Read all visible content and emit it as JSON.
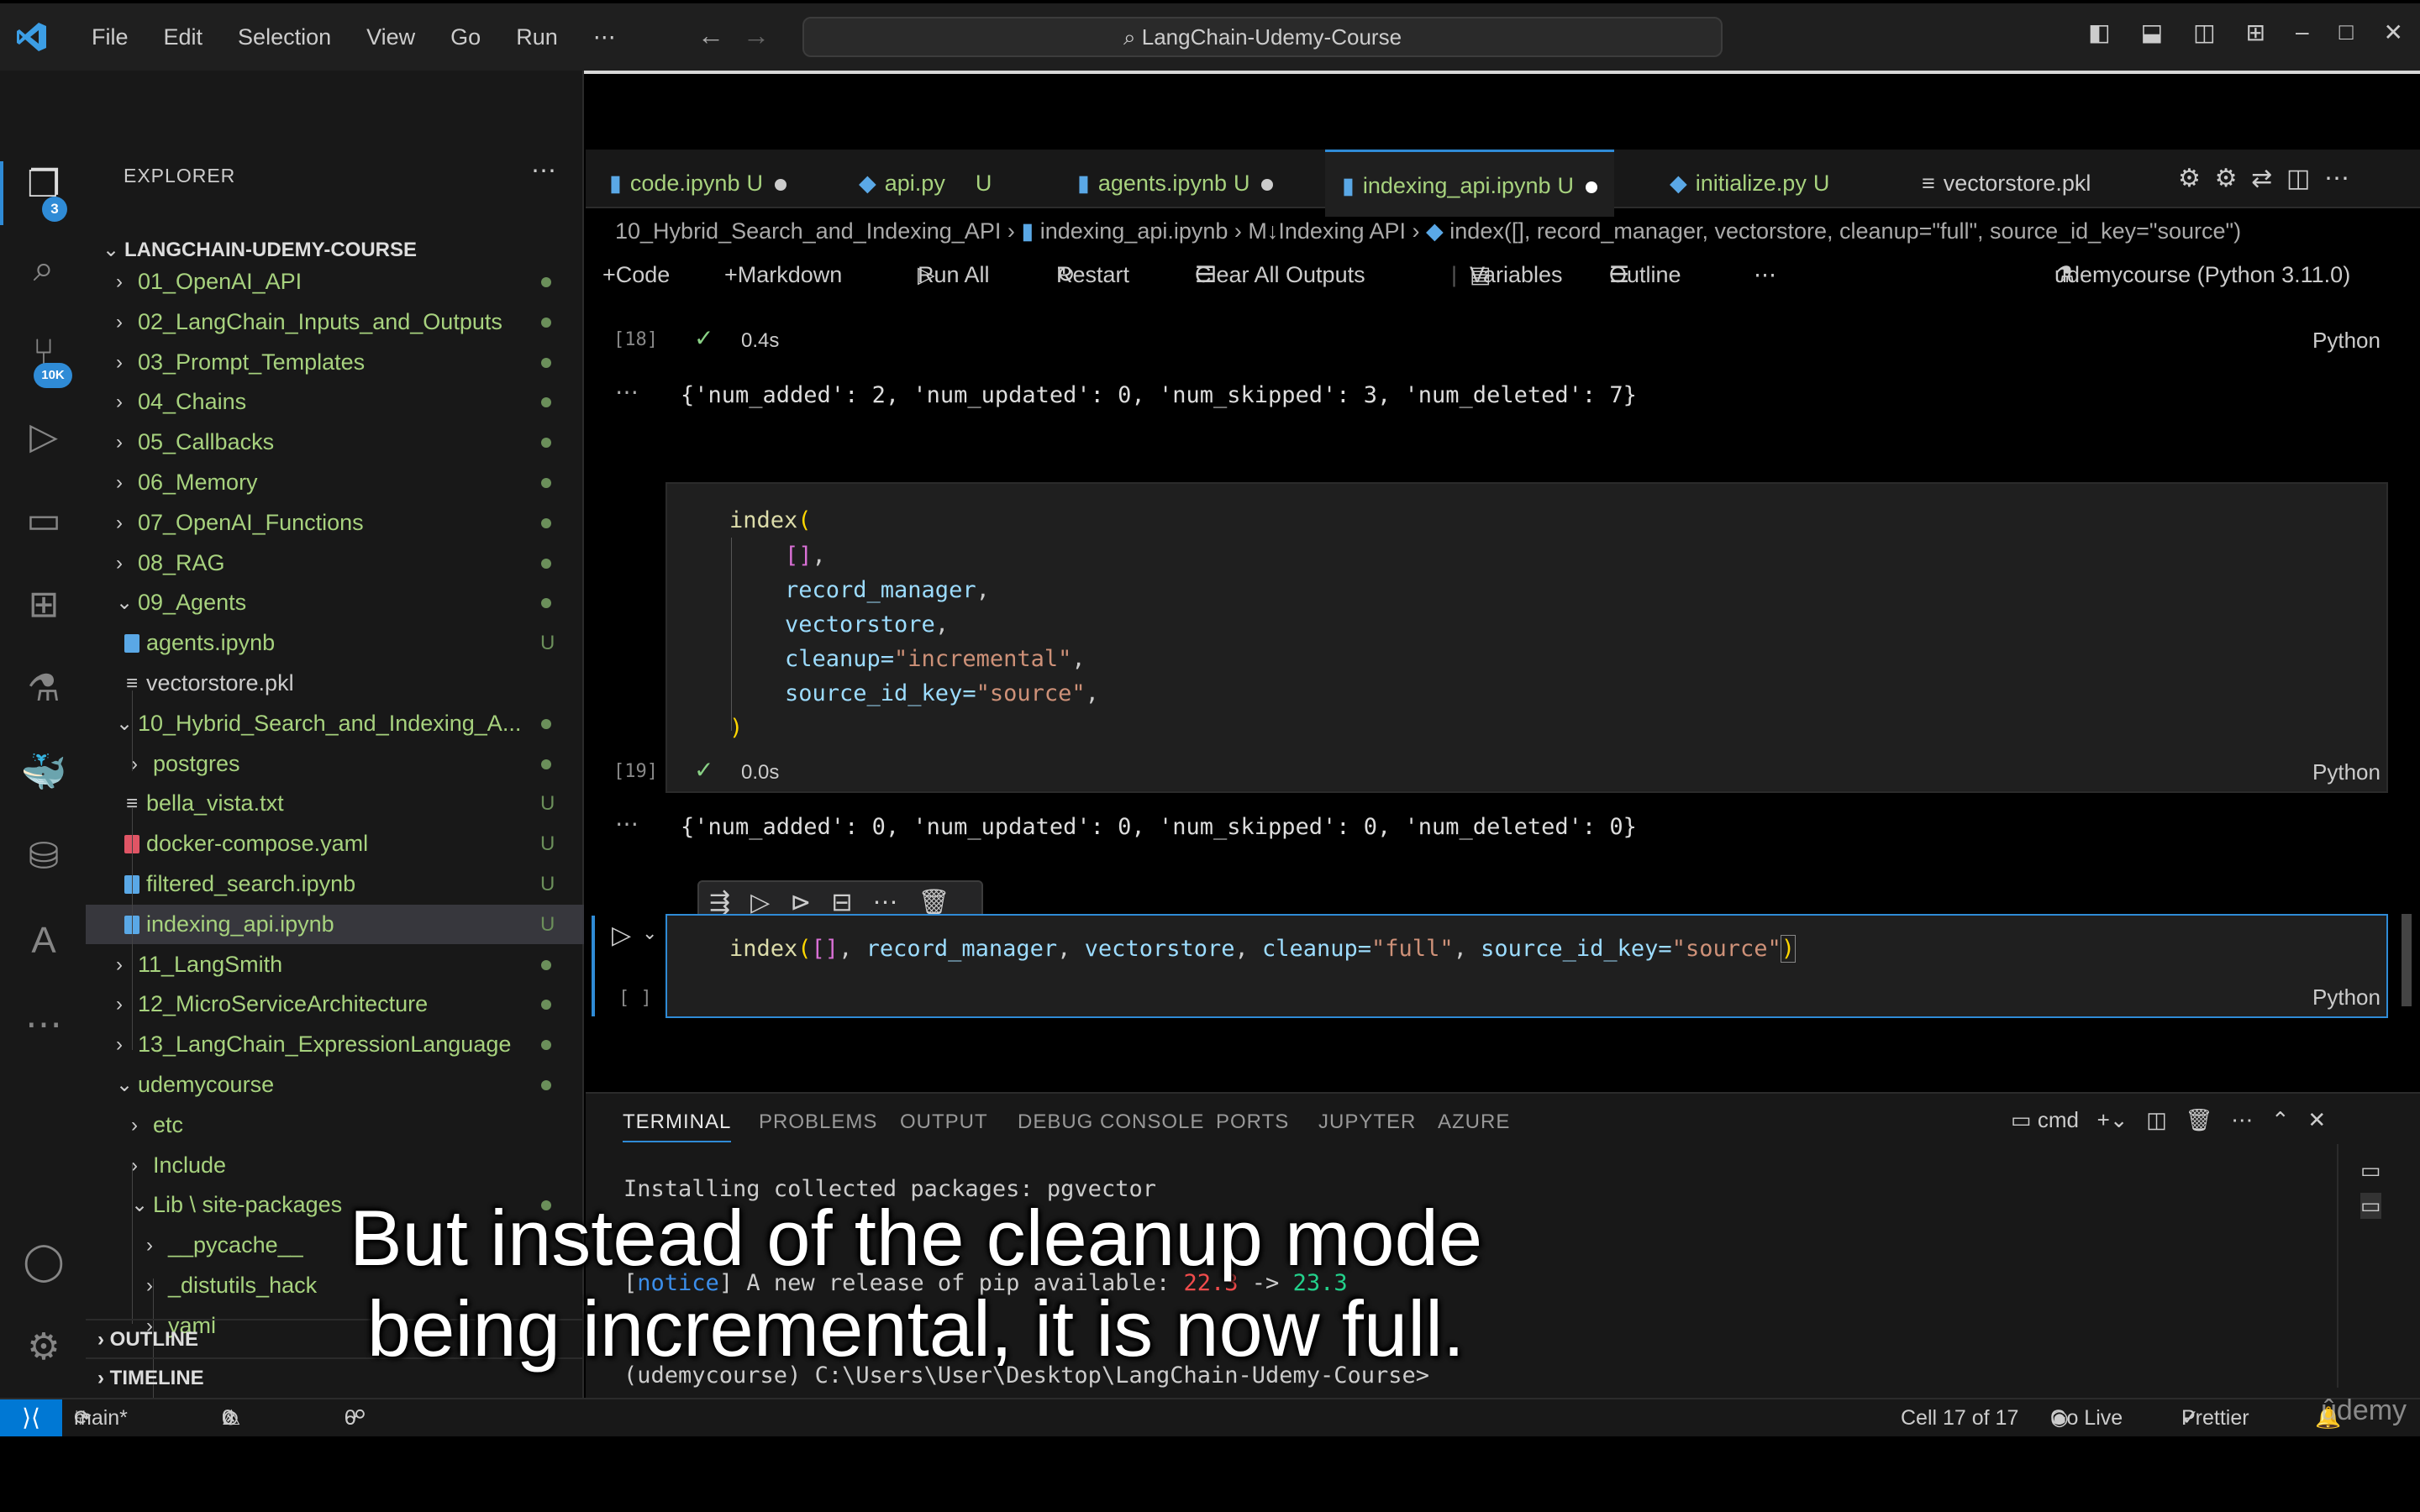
{
  "titlebar": {
    "menu": [
      "File",
      "Edit",
      "Selection",
      "View",
      "Go",
      "Run",
      "⋯"
    ],
    "search": "LangChain-Udemy-Course"
  },
  "activity": {
    "explorer_badge": "3",
    "scm_badge": "10K"
  },
  "sidebar": {
    "title": "EXPLORER",
    "root": "LANGCHAIN-UDEMY-COURSE",
    "items": [
      {
        "label": "01_OpenAI_API",
        "type": "folder"
      },
      {
        "label": "02_LangChain_Inputs_and_Outputs",
        "type": "folder"
      },
      {
        "label": "03_Prompt_Templates",
        "type": "folder"
      },
      {
        "label": "04_Chains",
        "type": "folder"
      },
      {
        "label": "05_Callbacks",
        "type": "folder"
      },
      {
        "label": "06_Memory",
        "type": "folder"
      },
      {
        "label": "07_OpenAI_Functions",
        "type": "folder"
      },
      {
        "label": "08_RAG",
        "type": "folder"
      },
      {
        "label": "09_Agents",
        "type": "folder-open"
      },
      {
        "label": "agents.ipynb",
        "type": "file",
        "status": "U"
      },
      {
        "label": "vectorstore.pkl",
        "type": "file"
      },
      {
        "label": "10_Hybrid_Search_and_Indexing_A...",
        "type": "folder-open"
      },
      {
        "label": "postgres",
        "type": "folder"
      },
      {
        "label": "bella_vista.txt",
        "type": "file",
        "status": "U"
      },
      {
        "label": "docker-compose.yaml",
        "type": "file",
        "status": "U"
      },
      {
        "label": "filtered_search.ipynb",
        "type": "file",
        "status": "U"
      },
      {
        "label": "indexing_api.ipynb",
        "type": "file",
        "status": "U"
      },
      {
        "label": "11_LangSmith",
        "type": "folder"
      },
      {
        "label": "12_MicroServiceArchitecture",
        "type": "folder"
      },
      {
        "label": "13_LangChain_ExpressionLanguage",
        "type": "folder"
      },
      {
        "label": "udemycourse",
        "type": "folder-open"
      },
      {
        "label": "etc",
        "type": "folder"
      },
      {
        "label": "Include",
        "type": "folder"
      },
      {
        "label": "Lib \\ site-packages",
        "type": "folder-open"
      },
      {
        "label": "__pycache__",
        "type": "folder"
      },
      {
        "label": "_distutils_hack",
        "type": "folder"
      },
      {
        "label": "yaml",
        "type": "folder"
      }
    ],
    "outline": "OUTLINE",
    "timeline": "TIMELINE"
  },
  "tabs": [
    {
      "label": "code.ipynb",
      "status": "U"
    },
    {
      "label": "api.py",
      "status": "U"
    },
    {
      "label": "agents.ipynb",
      "status": "U"
    },
    {
      "label": "indexing_api.ipynb",
      "status": "U"
    },
    {
      "label": "initialize.py",
      "status": "U"
    },
    {
      "label": "vectorstore.pkl",
      "status": ""
    }
  ],
  "breadcrumb": {
    "folder": "10_Hybrid_Search_and_Indexing_API",
    "file": "indexing_api.ipynb",
    "section": "M↓Indexing API",
    "symbol": "index([], record_manager, vectorstore, cleanup=\"full\", source_id_key=\"source\")"
  },
  "toolbar": {
    "code": "Code",
    "markdown": "Markdown",
    "run_all": "Run All",
    "restart": "Restart",
    "clear": "Clear All Outputs",
    "variables": "Variables",
    "outline": "Outline",
    "kernel": "udemycourse (Python 3.11.0)"
  },
  "cells": {
    "c18": {
      "exec": "[18]",
      "time": "0.4s",
      "lang": "Python",
      "output": "{'num_added': 2, 'num_updated': 0, 'num_skipped': 3, 'num_deleted': 7}"
    },
    "c19": {
      "exec": "[19]",
      "time": "0.0s",
      "lang": "Python",
      "output": "{'num_added': 0, 'num_updated': 0, 'num_skipped': 0, 'num_deleted': 0}",
      "code": {
        "fn": "index",
        "args_list": "[]",
        "rm": "record_manager",
        "vs": "vectorstore",
        "cleanup_kw": "cleanup=",
        "cleanup_val": "\"incremental\"",
        "sik_kw": "source_id_key=",
        "sik_val": "\"source\""
      }
    },
    "current": {
      "exec": "[ ]",
      "lang": "Python",
      "code": {
        "fn": "index",
        "list": "[]",
        "rm": "record_manager",
        "vs": "vectorstore",
        "cleanup_kw": "cleanup=",
        "cleanup_val": "\"full\"",
        "sik_kw": "source_id_key=",
        "sik_val": "\"source\""
      }
    }
  },
  "panel": {
    "tabs": [
      "TERMINAL",
      "PROBLEMS",
      "OUTPUT",
      "DEBUG CONSOLE",
      "PORTS",
      "JUPYTER",
      "AZURE"
    ],
    "shell": "cmd",
    "lines": {
      "l1": "Installing collected packages: pgvector",
      "notice_tag": "notice",
      "notice_text": " A new release of pip available: ",
      "old_ver": "22.3",
      "arrow": " -> ",
      "new_ver": "23.3",
      "prompt": "(udemycourse) C:\\Users\\User\\Desktop\\LangChain-Udemy-Course>"
    }
  },
  "status": {
    "branch": "main*",
    "errors": "0",
    "warnings": "0",
    "ports": "0",
    "cell": "Cell 17 of 17",
    "golive": "Go Live",
    "prettier": "Prettier"
  },
  "subtitle": {
    "line1": "But instead of the cleanup mode",
    "line2": "being incremental, it is now full."
  },
  "watermark": "ûdemy"
}
